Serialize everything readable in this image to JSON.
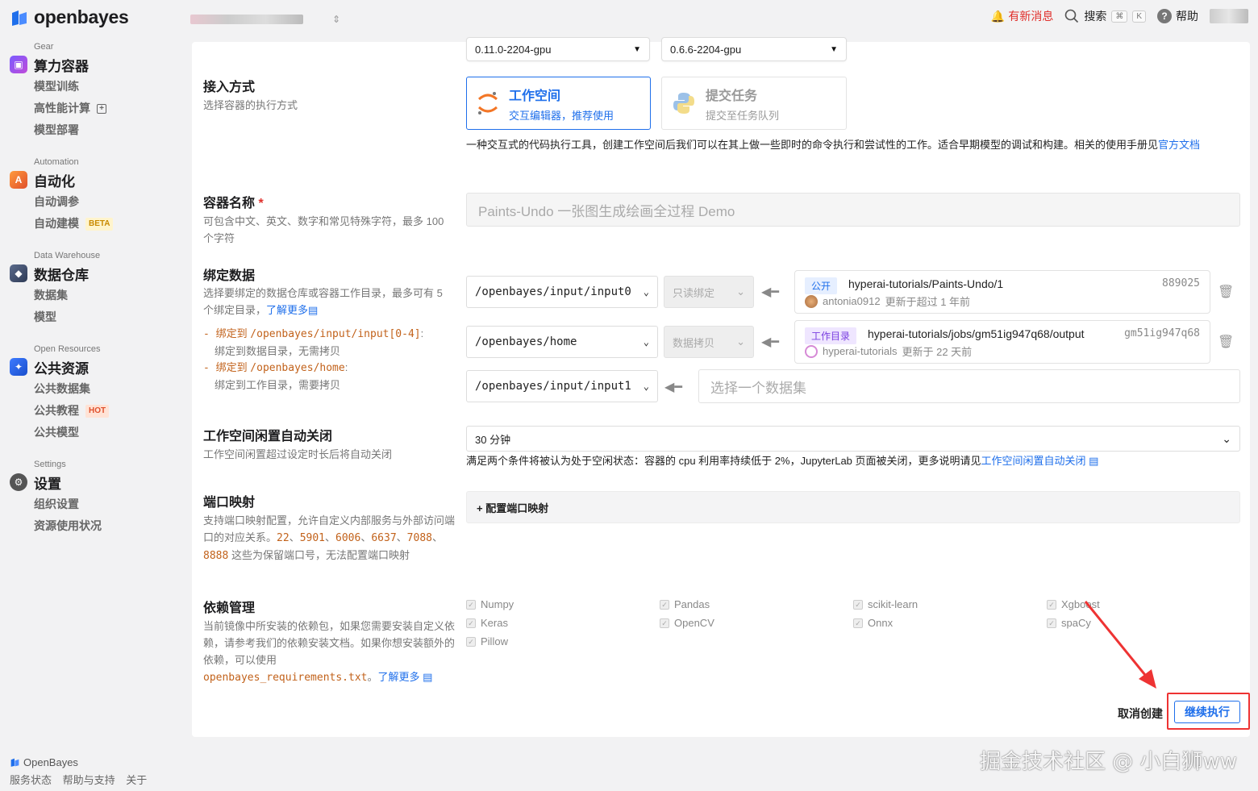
{
  "brand": {
    "name": "openbayes"
  },
  "header": {
    "news": "有新消息",
    "search": "搜索",
    "kbd_cmd": "⌘",
    "kbd_k": "K",
    "help": "帮助"
  },
  "sidebar": {
    "gear": {
      "label": "Gear",
      "title": "算力容器",
      "items": [
        "模型训练",
        "高性能计算",
        "模型部署"
      ]
    },
    "automation": {
      "label": "Automation",
      "title": "自动化",
      "items": [
        "自动调参",
        "自动建模"
      ],
      "badge": "BETA"
    },
    "warehouse": {
      "label": "Data Warehouse",
      "title": "数据仓库",
      "items": [
        "数据集",
        "模型"
      ]
    },
    "open": {
      "label": "Open Resources",
      "title": "公共资源",
      "items": [
        "公共数据集",
        "公共教程",
        "公共模型"
      ],
      "badge": "HOT"
    },
    "settings": {
      "label": "Settings",
      "title": "设置",
      "items": [
        "组织设置",
        "资源使用状况"
      ]
    }
  },
  "footer": {
    "brand": "OpenBayes",
    "links": [
      "服务状态",
      "帮助与支持",
      "关于"
    ]
  },
  "form": {
    "versions": [
      "0.11.0-2204-gpu",
      "0.6.6-2204-gpu"
    ],
    "access": {
      "title": "接入方式",
      "desc": "选择容器的执行方式",
      "workspace_title": "工作空间",
      "workspace_sub": "交互编辑器，推荐使用",
      "task_title": "提交任务",
      "task_sub": "提交至任务队列",
      "explain": "一种交互式的代码执行工具，创建工作空间后我们可以在其上做一些即时的命令执行和尝试性的工作。适合早期模型的调试和构建。相关的使用手册见",
      "explain_link": "官方文档"
    },
    "name": {
      "title": "容器名称",
      "required": "*",
      "desc": "可包含中文、英文、数字和常见特殊字符，最多 100 个字符",
      "value": "Paints-Undo 一张图生成绘画全过程 Demo"
    },
    "bind": {
      "title": "绑定数据",
      "desc": "选择要绑定的数据仓库或容器工作目录，最多可有 5 个绑定目录，",
      "learn_more": "了解更多",
      "hint1_prefix": "绑定到",
      "hint1_path": "/openbayes/input/input[0-4]",
      "hint1_desc": "绑定到数据目录，无需拷贝",
      "hint2_prefix": "绑定到",
      "hint2_path": "/openbayes/home",
      "hint2_desc": "绑定到工作目录，需要拷贝",
      "rows": [
        {
          "path": "/openbayes/input/input0",
          "mode": "只读绑定",
          "tag": "公开",
          "dataset": "hyperai-tutorials/Paints-Undo/1",
          "id": "889025",
          "user": "antonia0912",
          "updated": "更新于超过 1 年前"
        },
        {
          "path": "/openbayes/home",
          "mode": "数据拷贝",
          "tag": "工作目录",
          "dataset": "hyperai-tutorials/jobs/gm51ig947q68/output",
          "id": "gm51ig947q68",
          "user": "hyperai-tutorials",
          "updated": "更新于 22 天前"
        },
        {
          "path": "/openbayes/input/input1",
          "placeholder": "选择一个数据集"
        }
      ]
    },
    "idle": {
      "title": "工作空间闲置自动关闭",
      "desc": "工作空间闲置超过设定时长后将自动关闭",
      "value": "30 分钟",
      "explain": "满足两个条件将被认为处于空闲状态：容器的 cpu 利用率持续低于 2%，JupyterLab 页面被关闭，更多说明请见",
      "explain_link": "工作空间闲置自动关闭"
    },
    "port": {
      "title": "端口映射",
      "desc1": "支持端口映射配置，允许自定义内部服务与外部访问端口的对应关系。",
      "ports": [
        "22",
        "5901",
        "6006",
        "6637",
        "7088",
        "8888"
      ],
      "desc2": "这些为保留端口号，无法配置端口映射",
      "button": "+ 配置端口映射"
    },
    "deps": {
      "title": "依赖管理",
      "desc": "当前镜像中所安装的依赖包，如果您需要安装自定义依赖，请参考我们的依赖安装文档。如果你想安装额外的依赖，可以使用",
      "file": "openbayes_requirements.txt",
      "learn_more": "了解更多",
      "packages": [
        "Numpy",
        "Pandas",
        "scikit-learn",
        "Xgboost",
        "Keras",
        "OpenCV",
        "Onnx",
        "spaCy",
        "Pillow"
      ]
    },
    "actions": {
      "cancel": "取消创建",
      "continue": "继续执行"
    }
  },
  "watermark": "掘金技术社区 @ 小白狮ww"
}
